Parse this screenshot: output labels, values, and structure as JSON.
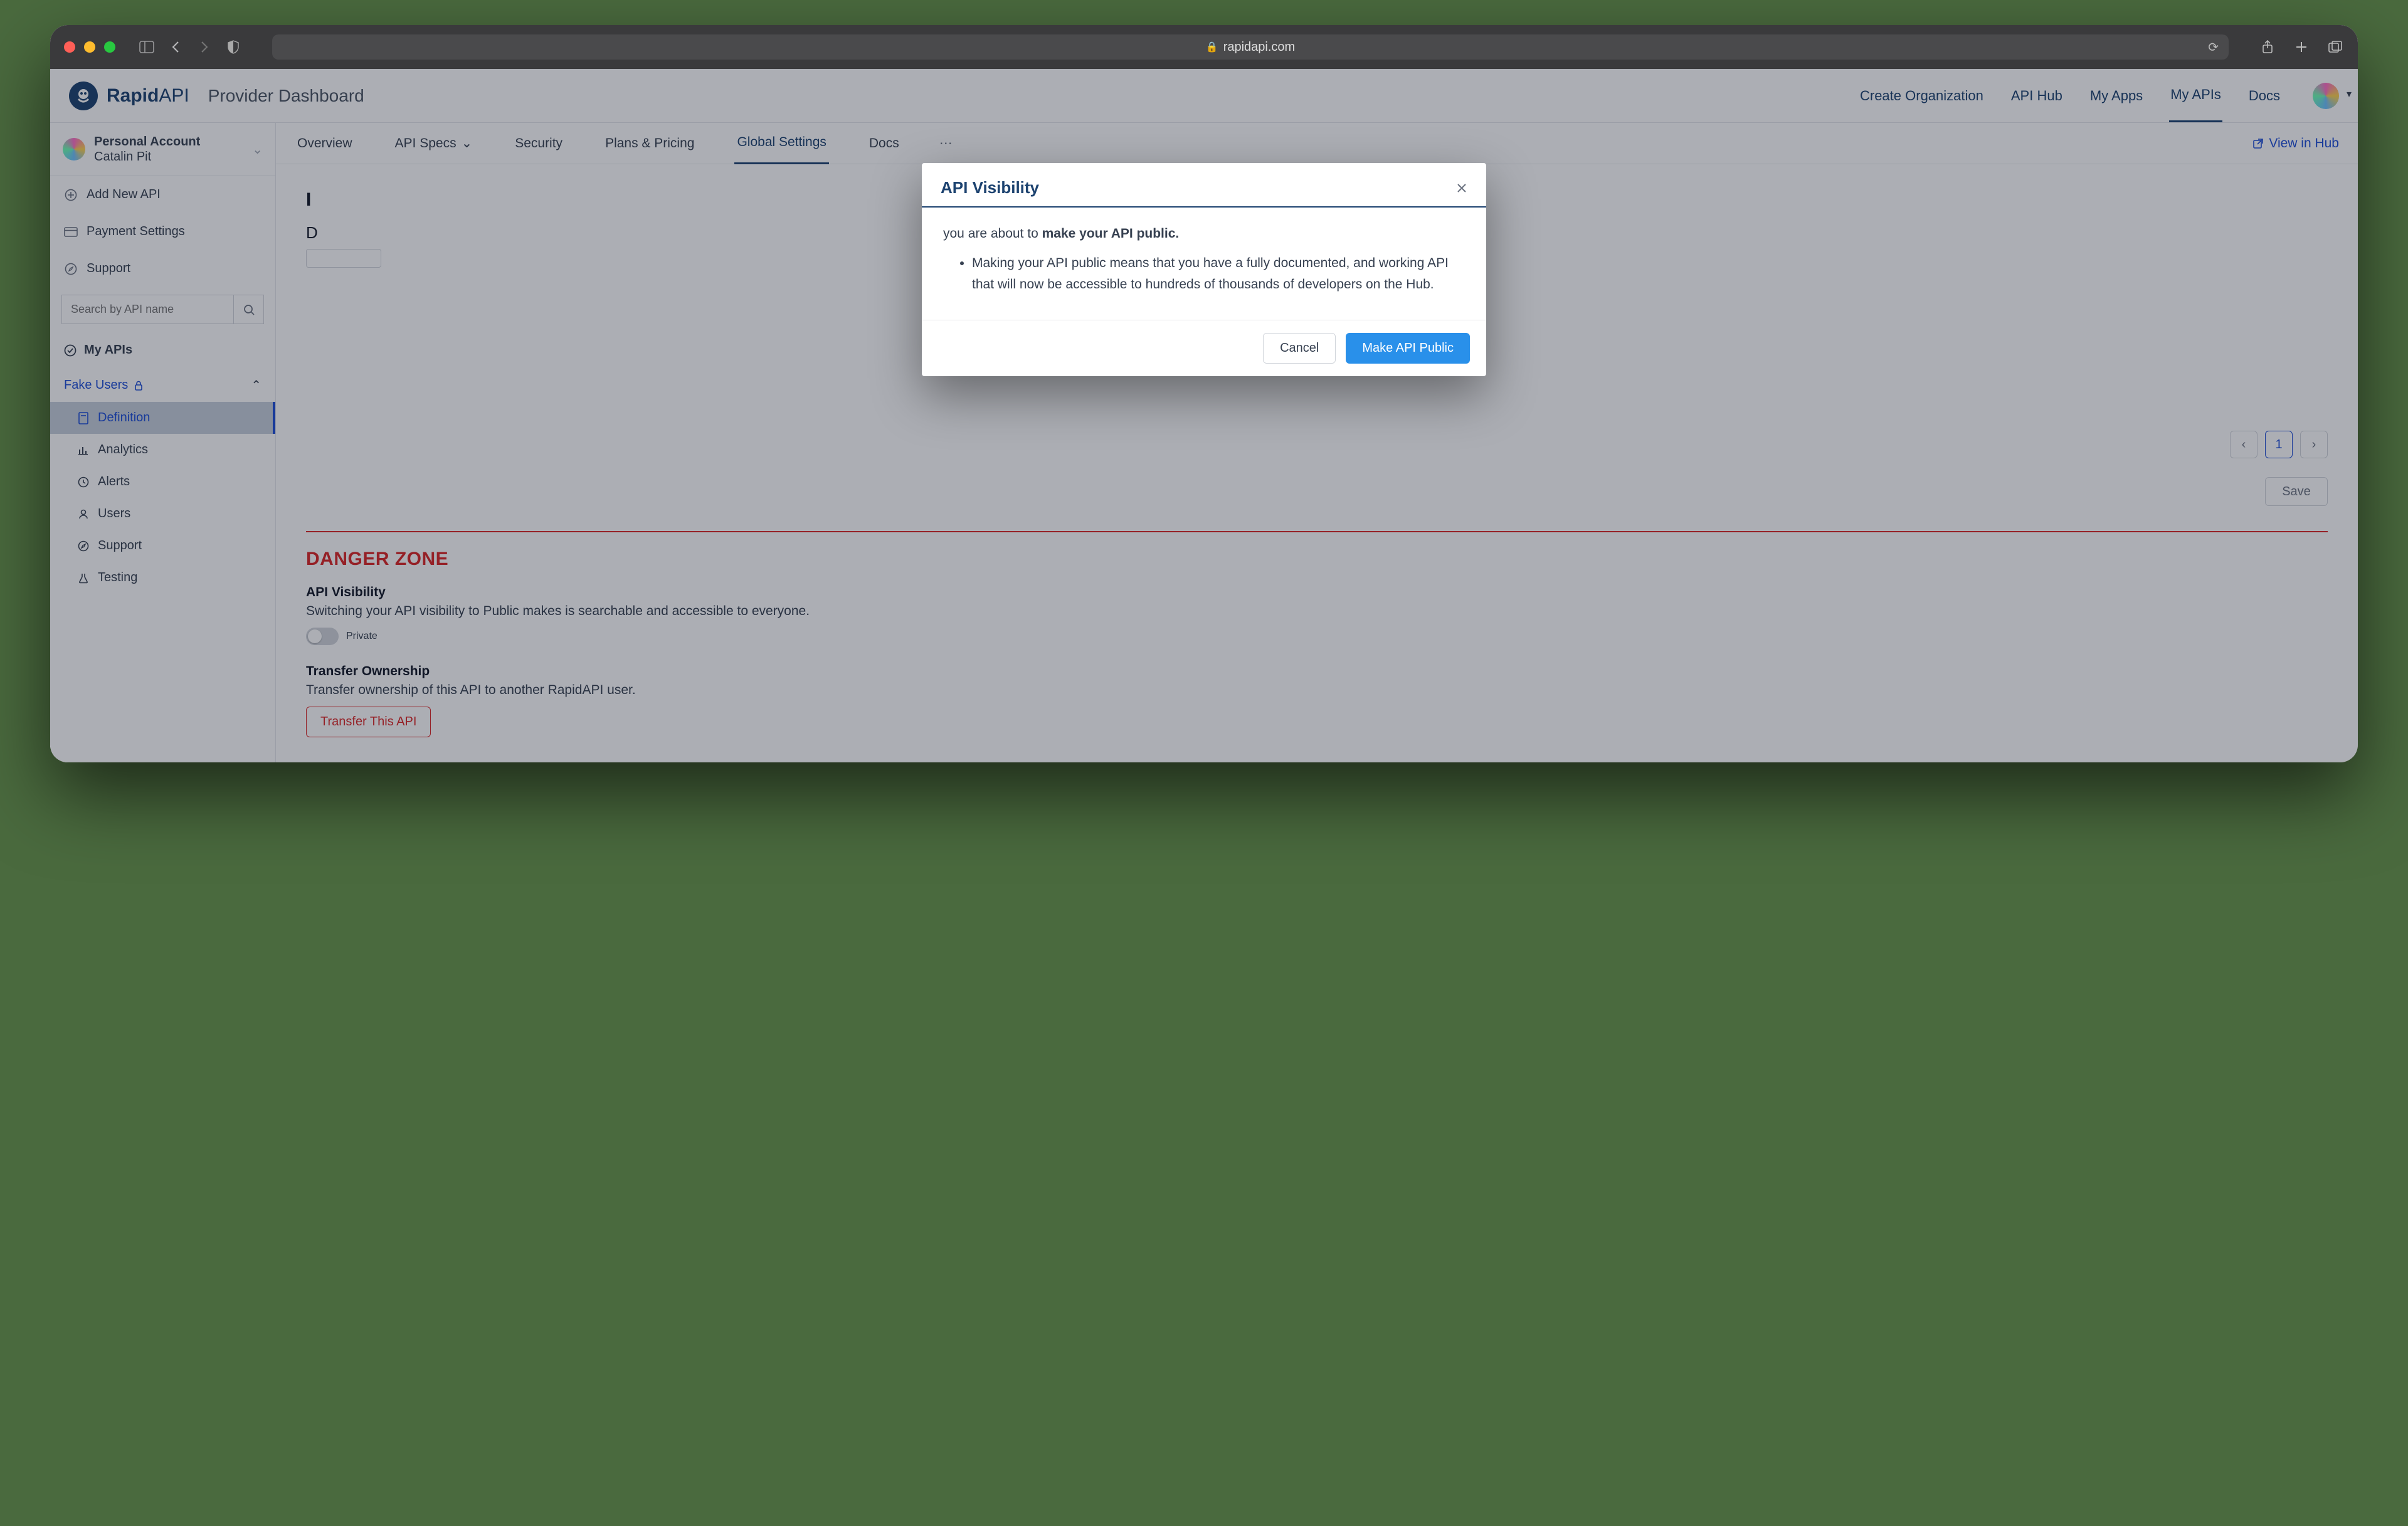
{
  "browser": {
    "url_host": "rapidapi.com"
  },
  "header": {
    "brand_main": "Rapid",
    "brand_suffix": "API",
    "subtitle": "Provider Dashboard",
    "nav": {
      "create_org": "Create Organization",
      "api_hub": "API Hub",
      "my_apps": "My Apps",
      "my_apis": "My APIs",
      "docs": "Docs"
    }
  },
  "sidebar": {
    "account_title": "Personal Account",
    "account_name": "Catalin Pit",
    "add_api": "Add New API",
    "payment": "Payment Settings",
    "support": "Support",
    "search_placeholder": "Search by API name",
    "section_my_apis": "My APIs",
    "api_name": "Fake Users",
    "sub": {
      "definition": "Definition",
      "analytics": "Analytics",
      "alerts": "Alerts",
      "users": "Users",
      "support": "Support",
      "testing": "Testing"
    }
  },
  "tabs": {
    "overview": "Overview",
    "api_specs": "API Specs",
    "security": "Security",
    "plans": "Plans & Pricing",
    "global": "Global Settings",
    "docs": "Docs",
    "view_hub": "View in Hub"
  },
  "page": {
    "leading_d": "D",
    "page_number": "1",
    "save": "Save",
    "danger_zone": "DANGER ZONE",
    "visibility_title": "API Visibility",
    "visibility_desc": "Switching your API visibility to Public makes is searchable and accessible to everyone.",
    "visibility_state": "Private",
    "transfer_title": "Transfer Ownership",
    "transfer_desc": "Transfer ownership of this API to another RapidAPI user.",
    "transfer_btn": "Transfer This API"
  },
  "modal": {
    "title": "API Visibility",
    "lead_pre": "you are about to ",
    "lead_bold": "make your API public.",
    "bullet": "Making your API public means that you have a fully documented, and working API that will now be accessible to hundreds of thousands of developers on the Hub.",
    "cancel": "Cancel",
    "confirm": "Make API Public"
  }
}
